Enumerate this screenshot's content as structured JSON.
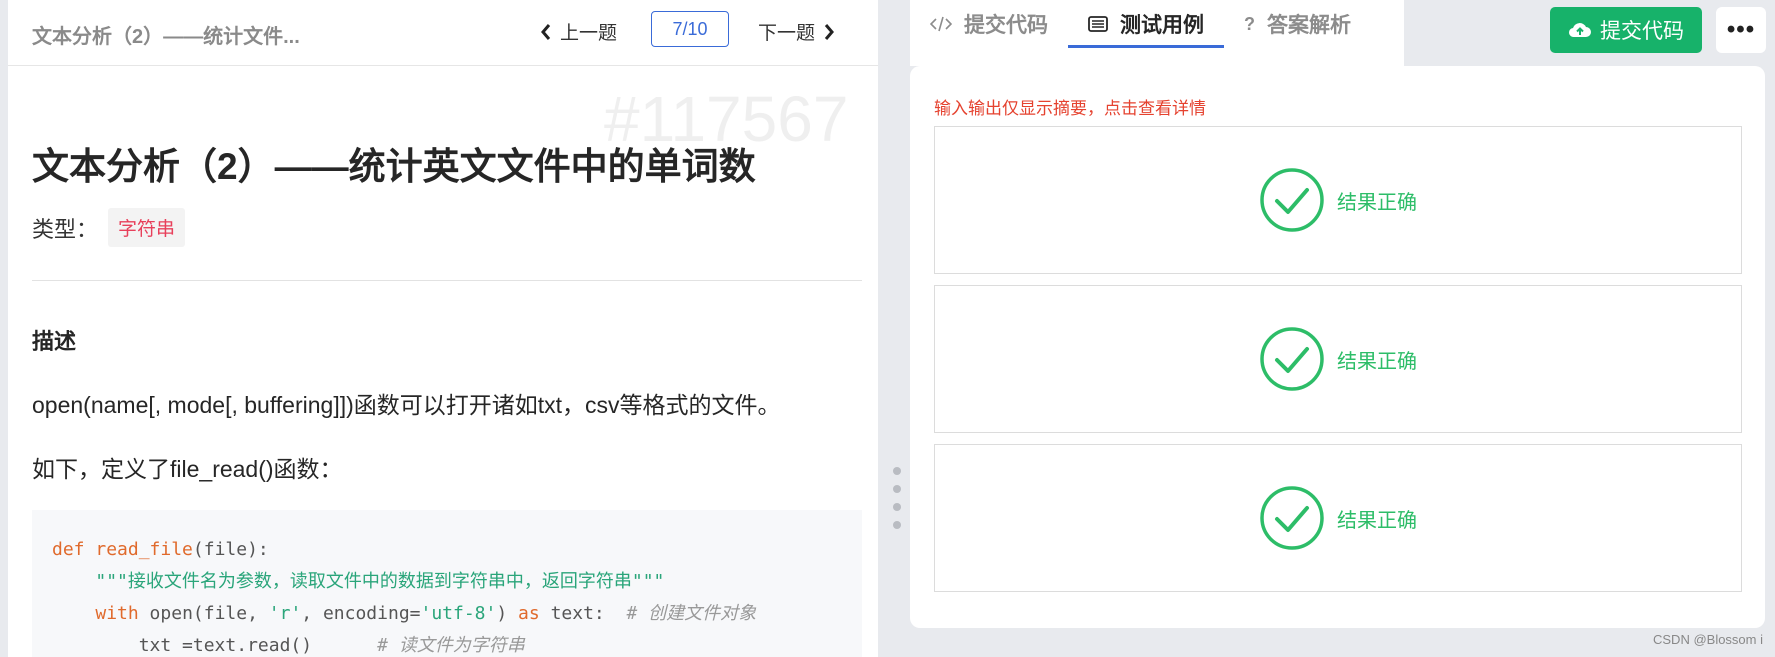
{
  "header": {
    "breadcrumb": "文本分析（2）——统计文件...",
    "prev_label": "上一题",
    "page_indicator": "7/10",
    "next_label": "下一题"
  },
  "problem": {
    "watermark": "#117567",
    "title": "文本分析（2）——统计英文文件中的单词数",
    "type_label": "类型：",
    "type_tag": "字符串",
    "description_heading": "描述",
    "paragraph1": "open(name[, mode[, buffering]])函数可以打开诸如txt，csv等格式的文件。",
    "paragraph2": "如下，定义了file_read()函数："
  },
  "code": {
    "line1_kw": "def",
    "line1_fn": "read_file",
    "line1_rest": "(file):",
    "line2_str": "\"\"\"接收文件名为参数，读取文件中的数据到字符串中，返回字符串\"\"\"",
    "line3_kw1": "with",
    "line3_mid": " open(file, ",
    "line3_str1": "'r'",
    "line3_mid2": ", encoding=",
    "line3_str2": "'utf-8'",
    "line3_mid3": ") ",
    "line3_kw2": "as",
    "line3_mid4": " text:  ",
    "line3_cm": "# 创建文件对象",
    "line4_code": "txt =text.read()      ",
    "line4_cm": "# 读文件为字符串"
  },
  "tabs": [
    {
      "label": "提交代码",
      "icon": "code-icon"
    },
    {
      "label": "测试用例",
      "icon": "list-icon"
    },
    {
      "label": "答案解析",
      "icon": "question-icon"
    }
  ],
  "actions": {
    "submit_label": "提交代码",
    "more_label": "•••"
  },
  "results": {
    "hint": "输入输出仅显示摘要，点击查看详情",
    "items": [
      {
        "text": "结果正确"
      },
      {
        "text": "结果正确"
      },
      {
        "text": "结果正确"
      }
    ]
  },
  "footer": "CSDN @Blossom i",
  "colors": {
    "accent": "#3a6bd8",
    "success": "#17b26a",
    "success_text": "#2dbd68",
    "tag": "#e8405b",
    "hint": "#e5422f"
  }
}
